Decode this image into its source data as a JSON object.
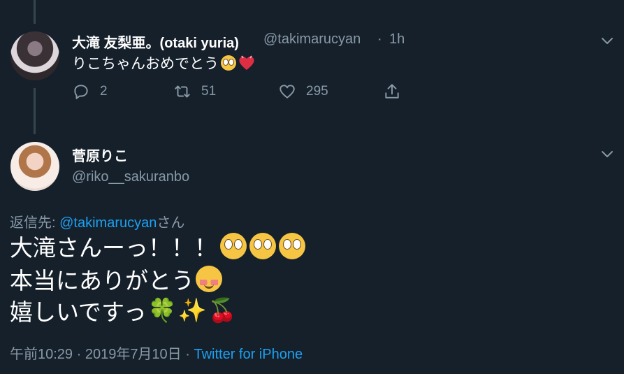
{
  "colors": {
    "background": "#15202b",
    "text": "#ffffff",
    "muted": "#8899a6",
    "link": "#1da1f2",
    "thread_line": "#38444d"
  },
  "tweet_reply_parent": {
    "display_name": "大滝 友梨亜。(otaki yuria)",
    "handle": "@takimarucyan",
    "separator": "·",
    "time": "1h",
    "text": "りこちゃんおめでとう",
    "emojis": [
      "face-with-rolling-eyes-emoji",
      "growing-heart-emoji"
    ],
    "actions": {
      "reply_count": "2",
      "retweet_count": "51",
      "like_count": "295"
    }
  },
  "tweet_main": {
    "display_name": "菅原りこ",
    "handle": "@riko__sakuranbo",
    "reply_to_prefix": "返信先: ",
    "reply_to_mention": "@takimarucyan",
    "reply_to_suffix": "さん",
    "lines": [
      "大滝さんーっ！！！",
      "本当にありがとう",
      "嬉しいですっ"
    ],
    "line3_emojis": [
      "🍀",
      "✨",
      "🍒"
    ],
    "footer_time": "午前10:29 · 2019年7月10日 · ",
    "footer_client": "Twitter for iPhone"
  }
}
